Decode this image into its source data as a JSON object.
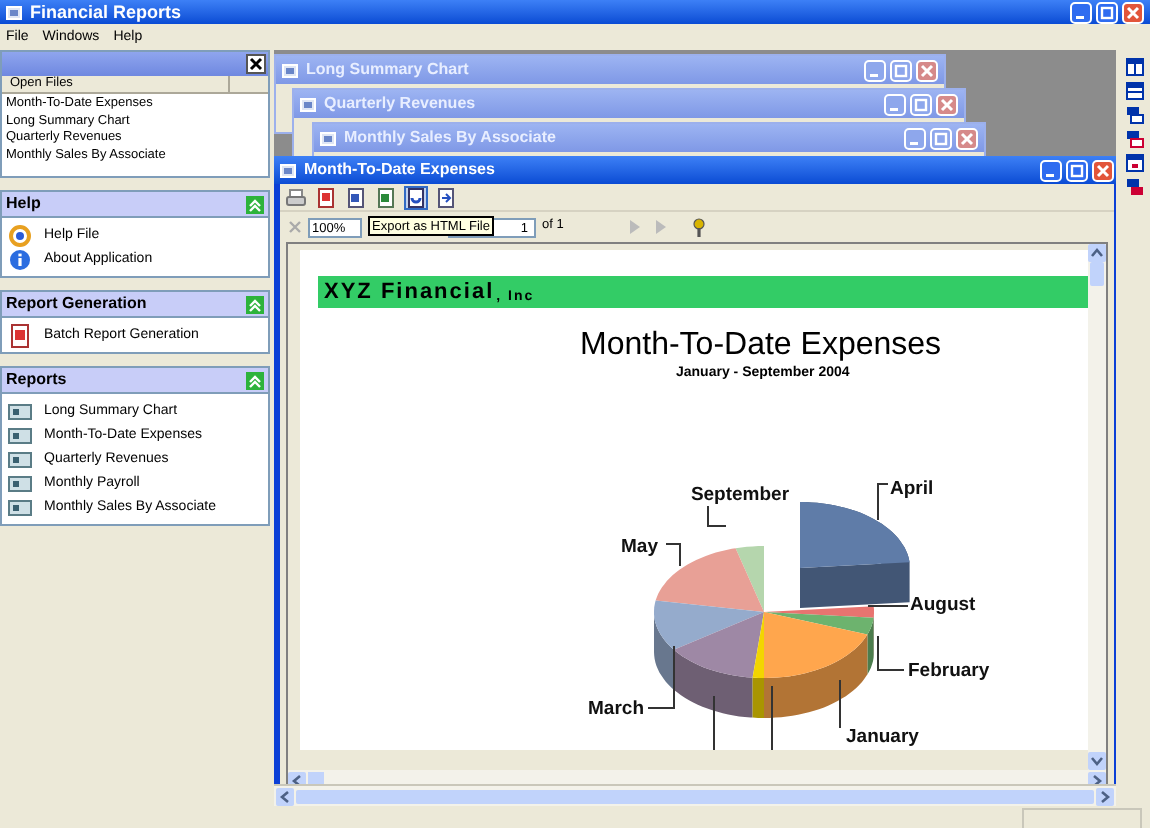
{
  "app_title": "Financial Reports",
  "menu": [
    "File",
    "Windows",
    "Help"
  ],
  "open_files": {
    "column": "Open Files",
    "items": [
      "Month-To-Date Expenses",
      "Long Summary Chart",
      "Quarterly Revenues",
      "Monthly Sales By Associate"
    ]
  },
  "panels": [
    {
      "title": "Help",
      "items": [
        {
          "label": "Help File",
          "kind": "help"
        },
        {
          "label": "About Application",
          "kind": "info"
        }
      ]
    },
    {
      "title": "Report Generation",
      "items": [
        {
          "label": "Batch Report Generation",
          "kind": "pdf"
        }
      ]
    },
    {
      "title": "Reports",
      "items": [
        {
          "label": "Long Summary Chart",
          "kind": "report"
        },
        {
          "label": "Month-To-Date Expenses",
          "kind": "report"
        },
        {
          "label": "Quarterly Revenues",
          "kind": "report"
        },
        {
          "label": "Monthly Payroll",
          "kind": "report"
        },
        {
          "label": "Monthly Sales By Associate",
          "kind": "report"
        }
      ]
    }
  ],
  "windows": [
    {
      "title": "Long Summary Chart",
      "active": false
    },
    {
      "title": "Quarterly Revenues",
      "active": false
    },
    {
      "title": "Monthly Sales By Associate",
      "active": false
    },
    {
      "title": "Month-To-Date Expenses",
      "active": true
    }
  ],
  "toolbar": [
    {
      "kind": "print",
      "selected": false
    },
    {
      "kind": "pdf",
      "selected": false
    },
    {
      "kind": "word",
      "selected": false
    },
    {
      "kind": "excel",
      "selected": false
    },
    {
      "kind": "html",
      "selected": true
    },
    {
      "kind": "export",
      "selected": false
    }
  ],
  "viewer": {
    "zoom": "100%",
    "tooltip": "Export as HTML File",
    "page": "1",
    "page_count": "of 1"
  },
  "report": {
    "company": "XYZ Financial",
    "company_suffix": ", Inc",
    "title": "Month-To-Date Expenses",
    "subtitle": "January - September 2004",
    "slices": [
      {
        "label": "April",
        "color": "#5f7ca8"
      },
      {
        "label": "August",
        "color": "#e87470"
      },
      {
        "label": "February",
        "color": "#6db36e"
      },
      {
        "label": "January",
        "color": "#ffa64d"
      },
      {
        "color": "#f2d500"
      },
      {
        "color": "#9e88a5"
      },
      {
        "label": "March",
        "color": "#95abcc"
      },
      {
        "label": "May",
        "color": "#e8a096"
      },
      {
        "label": "September",
        "color": "#b5d6ad"
      }
    ]
  }
}
